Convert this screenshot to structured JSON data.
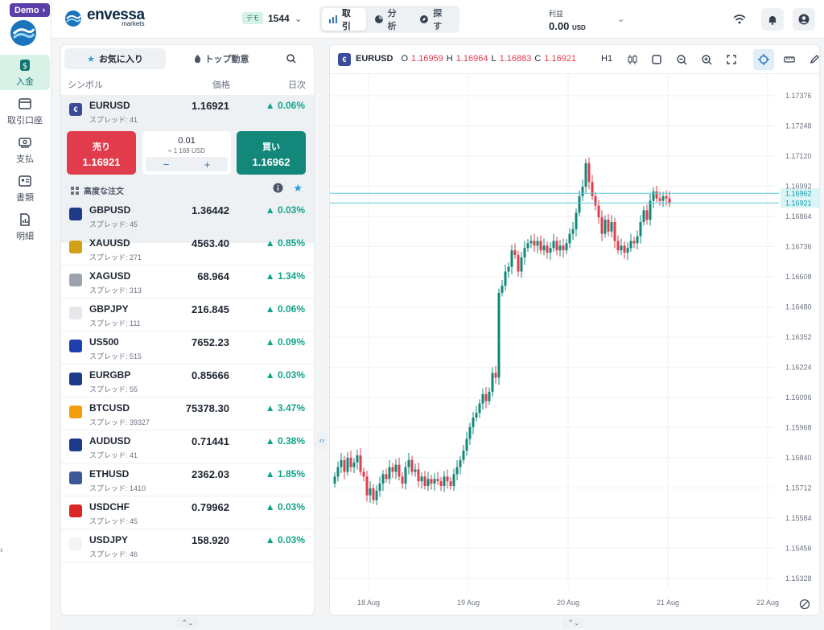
{
  "nav": {
    "demo_label": "Demo",
    "items": [
      {
        "label": "入金",
        "icon": "deposit-icon",
        "active": true
      },
      {
        "label": "取引口座",
        "icon": "trading-account-icon",
        "active": false
      },
      {
        "label": "支払",
        "icon": "payment-icon",
        "active": false
      },
      {
        "label": "書類",
        "icon": "documents-icon",
        "active": false
      },
      {
        "label": "明細",
        "icon": "statement-icon",
        "active": false
      }
    ]
  },
  "header": {
    "brand": "envessa",
    "brand_sub": "markets",
    "account_tag": "デモ",
    "account_id": "1544",
    "modes": [
      {
        "label": "取引",
        "active": true
      },
      {
        "label": "分析",
        "active": false
      },
      {
        "label": "探す",
        "active": false
      }
    ],
    "pnl_label": "利益",
    "pnl_value": "0.00",
    "pnl_unit": "USD"
  },
  "watchlist": {
    "tabs": [
      {
        "label": "お気に入り",
        "active": true
      },
      {
        "label": "トップ動意",
        "active": false
      }
    ],
    "columns": {
      "symbol": "シンボル",
      "price": "価格",
      "change": "日次"
    },
    "selected": {
      "symbol": "EURUSD",
      "spread": "スプレッド: 41",
      "price": "1.16921",
      "change": "0.06%",
      "sell_label": "売り",
      "sell_price": "1.16921",
      "buy_label": "買い",
      "buy_price": "1.16962",
      "lot": "0.01",
      "lot_usd": "≈ 1 169 USD",
      "advanced_label": "高度な注文"
    },
    "rows": [
      {
        "symbol": "GBPUSD",
        "spread": "スプレッド: 45",
        "price": "1.36442",
        "change": "0.03%",
        "flag": "#1e3a8a"
      },
      {
        "symbol": "XAUUSD",
        "spread": "スプレッド: 271",
        "price": "4563.40",
        "change": "0.85%",
        "flag": "#d4a017"
      },
      {
        "symbol": "XAGUSD",
        "spread": "スプレッド: 313",
        "price": "68.964",
        "change": "1.34%",
        "flag": "#9ca3af"
      },
      {
        "symbol": "GBPJPY",
        "spread": "スプレッド: 111",
        "price": "216.845",
        "change": "0.06%",
        "flag": "#e5e7eb"
      },
      {
        "symbol": "US500",
        "spread": "スプレッド: 515",
        "price": "7652.23",
        "change": "0.09%",
        "flag": "#1e40af"
      },
      {
        "symbol": "EURGBP",
        "spread": "スプレッド: 55",
        "price": "0.85666",
        "change": "0.03%",
        "flag": "#1e3a8a"
      },
      {
        "symbol": "BTCUSD",
        "spread": "スプレッド: 39327",
        "price": "75378.30",
        "change": "3.47%",
        "flag": "#f59e0b"
      },
      {
        "symbol": "AUDUSD",
        "spread": "スプレッド: 41",
        "price": "0.71441",
        "change": "0.38%",
        "flag": "#1e3a8a"
      },
      {
        "symbol": "ETHUSD",
        "spread": "スプレッド: 1410",
        "price": "2362.03",
        "change": "1.85%",
        "flag": "#3b5998"
      },
      {
        "symbol": "USDCHF",
        "spread": "スプレッド: 45",
        "price": "0.79962",
        "change": "0.03%",
        "flag": "#dc2626"
      },
      {
        "symbol": "USDJPY",
        "spread": "スプレッド: 46",
        "price": "158.920",
        "change": "0.03%",
        "flag": "#f3f4f6"
      }
    ]
  },
  "chart_header": {
    "symbol": "EURUSD",
    "o_label": "O",
    "o": "1.16959",
    "h_label": "H",
    "h": "1.16964",
    "l_label": "L",
    "l": "1.16883",
    "c_label": "C",
    "c": "1.16921",
    "timeframe": "H1"
  },
  "chart_data": {
    "type": "candlestick",
    "ylim": [
      1.153,
      1.174
    ],
    "yticks": [
      "1.17376",
      "1.17248",
      "1.17120",
      "1.16992",
      "1.16864",
      "1.16736",
      "1.16608",
      "1.16480",
      "1.16352",
      "1.16224",
      "1.16096",
      "1.15968",
      "1.15840",
      "1.15712",
      "1.15584",
      "1.15456",
      "1.15328"
    ],
    "ytick_values": [
      1.17376,
      1.17248,
      1.1712,
      1.16992,
      1.16864,
      1.16736,
      1.16608,
      1.1648,
      1.16352,
      1.16224,
      1.16096,
      1.15968,
      1.1584,
      1.15712,
      1.15584,
      1.15456,
      1.15328
    ],
    "xticks": [
      "18 Aug",
      "19 Aug",
      "20 Aug",
      "21 Aug",
      "22 Aug"
    ],
    "xtick_index": [
      6,
      37,
      68,
      99,
      130
    ],
    "bid_line": {
      "label": "1.16921",
      "value": 1.16921
    },
    "ask_line": {
      "label": "1.16962",
      "value": 1.16962
    },
    "up_color": "#12877a",
    "down_color": "#e13c4c",
    "closes": [
      1.1576,
      1.158,
      1.1583,
      1.1578,
      1.1584,
      1.158,
      1.1582,
      1.1585,
      1.1578,
      1.1576,
      1.1568,
      1.1571,
      1.1566,
      1.157,
      1.1573,
      1.1577,
      1.1575,
      1.158,
      1.1578,
      1.1581,
      1.1576,
      1.1573,
      1.158,
      1.1583,
      1.1578,
      1.1579,
      1.1574,
      1.1576,
      1.1572,
      1.1575,
      1.1573,
      1.1575,
      1.1574,
      1.1572,
      1.1576,
      1.1574,
      1.1572,
      1.1577,
      1.158,
      1.1583,
      1.1587,
      1.1592,
      1.1597,
      1.1601,
      1.1603,
      1.1607,
      1.1611,
      1.1608,
      1.1612,
      1.162,
      1.1618,
      1.1654,
      1.1657,
      1.1663,
      1.1665,
      1.1672,
      1.167,
      1.1663,
      1.1669,
      1.1673,
      1.1675,
      1.1676,
      1.1674,
      1.1676,
      1.1672,
      1.1674,
      1.1671,
      1.1673,
      1.1676,
      1.1672,
      1.1674,
      1.1672,
      1.1675,
      1.1679,
      1.1681,
      1.1688,
      1.1695,
      1.1699,
      1.1709,
      1.1701,
      1.1695,
      1.1691,
      1.1686,
      1.1679,
      1.1685,
      1.168,
      1.1684,
      1.1676,
      1.1672,
      1.1674,
      1.1671,
      1.1673,
      1.1676,
      1.1675,
      1.1678,
      1.1684,
      1.1689,
      1.1685,
      1.1693,
      1.1697,
      1.1694,
      1.1693,
      1.1695,
      1.1694,
      1.1692
    ]
  },
  "footer": {
    "reset_icon": "reset-zoom-icon"
  }
}
